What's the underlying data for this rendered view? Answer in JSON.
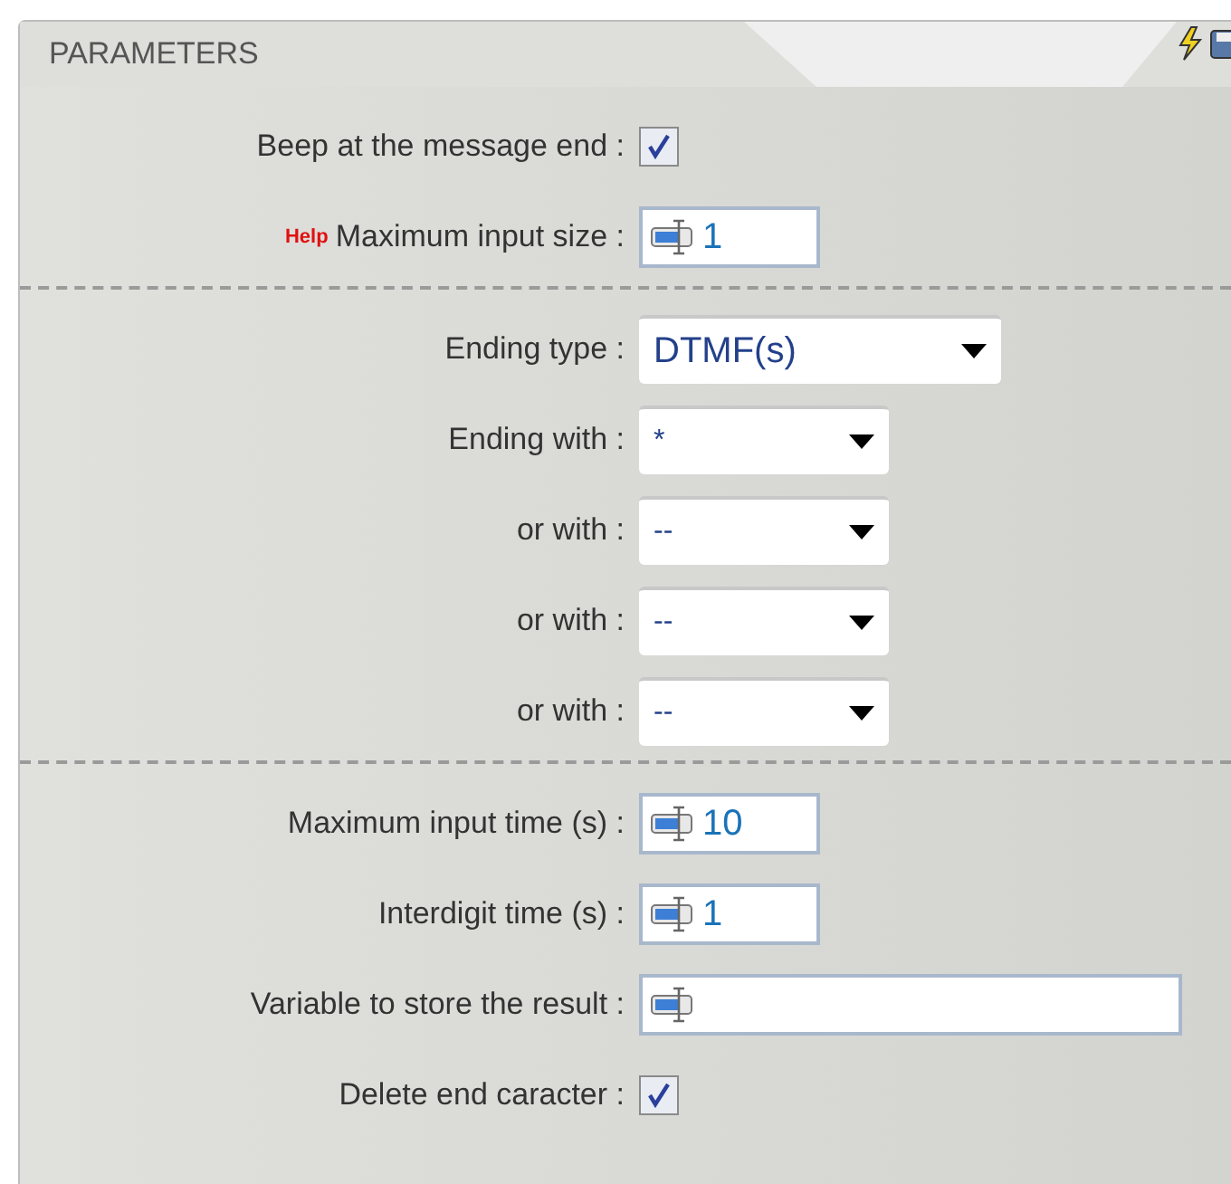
{
  "panel": {
    "title": "PARAMETERS"
  },
  "sections": [
    {
      "rows": [
        {
          "kind": "checkbox",
          "label": "Beep at the message end :",
          "checked": true
        },
        {
          "kind": "text",
          "help": "Help",
          "label": "Maximum input size :",
          "value": "1"
        }
      ]
    },
    {
      "rows": [
        {
          "kind": "wide_select",
          "label": "Ending type :",
          "value": "DTMF(s)"
        },
        {
          "kind": "select",
          "label": "Ending with :",
          "value": "*"
        },
        {
          "kind": "select",
          "label": "or with :",
          "value": "--"
        },
        {
          "kind": "select",
          "label": "or with :",
          "value": "--"
        },
        {
          "kind": "select",
          "label": "or with :",
          "value": "--"
        }
      ]
    },
    {
      "rows": [
        {
          "kind": "text",
          "label": "Maximum input time (s) :",
          "value": "10"
        },
        {
          "kind": "text",
          "label": "Interdigit time (s) :",
          "value": "1"
        },
        {
          "kind": "wide_text",
          "label": "Variable to store the result :"
        },
        {
          "kind": "checkbox",
          "label": "Delete end caracter :",
          "checked": true
        }
      ]
    }
  ]
}
